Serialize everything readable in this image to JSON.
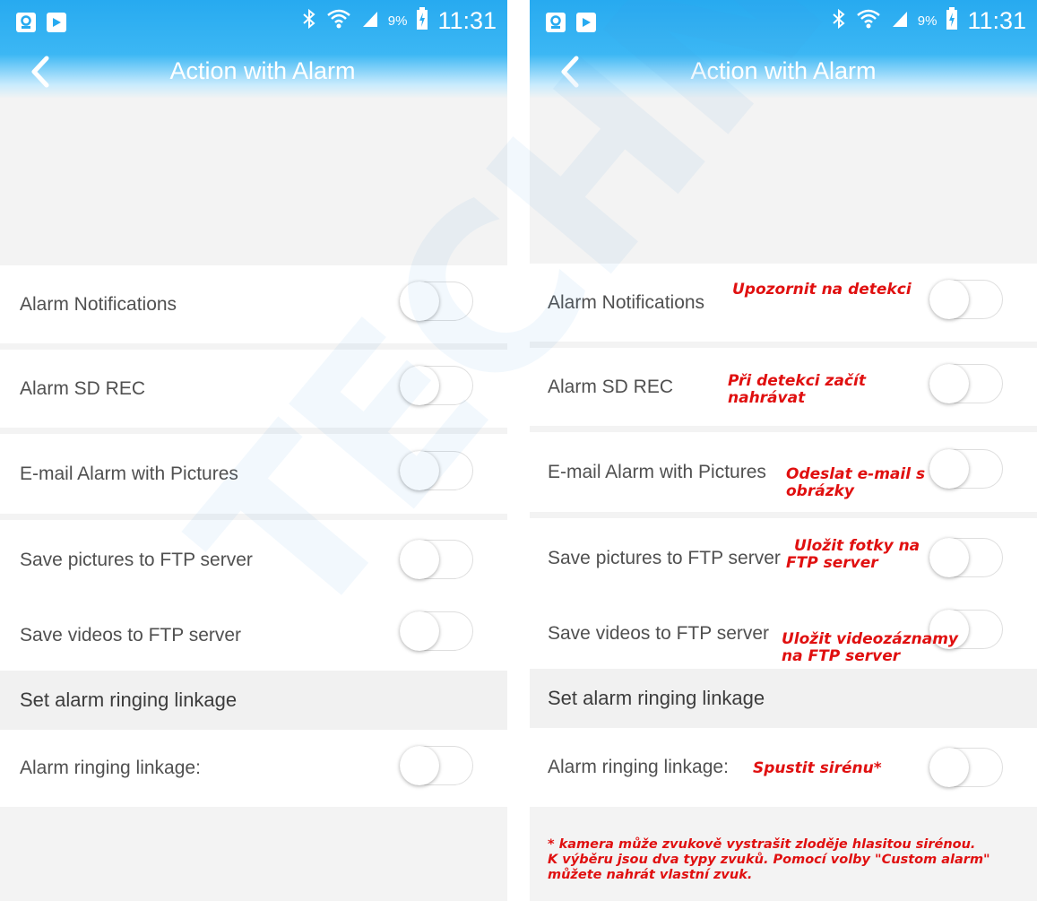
{
  "status_bar": {
    "battery": "9%",
    "time": "11:31"
  },
  "header": {
    "title": "Action with Alarm"
  },
  "settings": [
    {
      "label": "Alarm Notifications"
    },
    {
      "label": "Alarm SD REC"
    },
    {
      "label": "E-mail Alarm with Pictures"
    },
    {
      "label": "Save pictures to FTP server"
    },
    {
      "label": "Save videos to FTP server"
    }
  ],
  "ringing_section": {
    "header": "Set alarm ringing linkage",
    "label": "Alarm ringing linkage:"
  },
  "toggles_state": "off",
  "annotations": {
    "notifications": "Upozornit na detekci",
    "sd_rec_1": "Při detekci začít",
    "sd_rec_2": "nahrávat",
    "email_1": "Odeslat e-mail s",
    "email_2": "obrázky",
    "pics_1": "Uložit fotky na",
    "pics_2": "FTP server",
    "videos_1": "Uložit videozáznamy",
    "videos_2": "na FTP server",
    "ringing": "Spustit sirénu*"
  },
  "footnote": {
    "line1": "* kamera může zvukově vystrašit zloděje hlasitou sirénou.",
    "line2": "K výběru jsou dva typy zvuků. Pomocí volby \"Custom alarm\"",
    "line3": "můžete nahrát vlastní zvuk."
  },
  "watermark": "TECHNIK.cz",
  "colors": {
    "accent": "#29abf1",
    "annotation": "#e01010"
  }
}
